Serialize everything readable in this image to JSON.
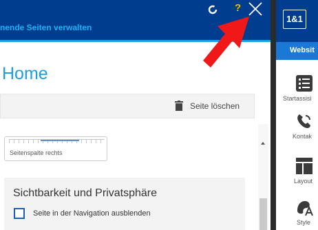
{
  "panel": {
    "header_title": "nende Seiten verwalten",
    "help_label": "?",
    "page_title": "Home",
    "delete_label": "Seite löschen",
    "layout_card_label": "Seitenspalte rechts",
    "privacy": {
      "title": "Sichtbarkeit und Privatsphäre",
      "hide_in_nav_label": "Seite in der Navigation ausblenden",
      "hide_in_nav_checked": false
    }
  },
  "sidebar": {
    "brand": "1&1",
    "active_tab": "Websit",
    "items": [
      {
        "label": "Startassisi",
        "icon": "checklist-icon"
      },
      {
        "label": "Kontak",
        "icon": "phone-icon"
      },
      {
        "label": "Layout",
        "icon": "layout-icon"
      },
      {
        "label": "Style",
        "icon": "style-icon"
      }
    ]
  },
  "colors": {
    "header_bg": "#003d8f",
    "accent_blue": "#1aa2e8",
    "help_yellow": "#f2b705",
    "arrow_red": "#f01818",
    "tab_blue": "#1a78d6"
  }
}
